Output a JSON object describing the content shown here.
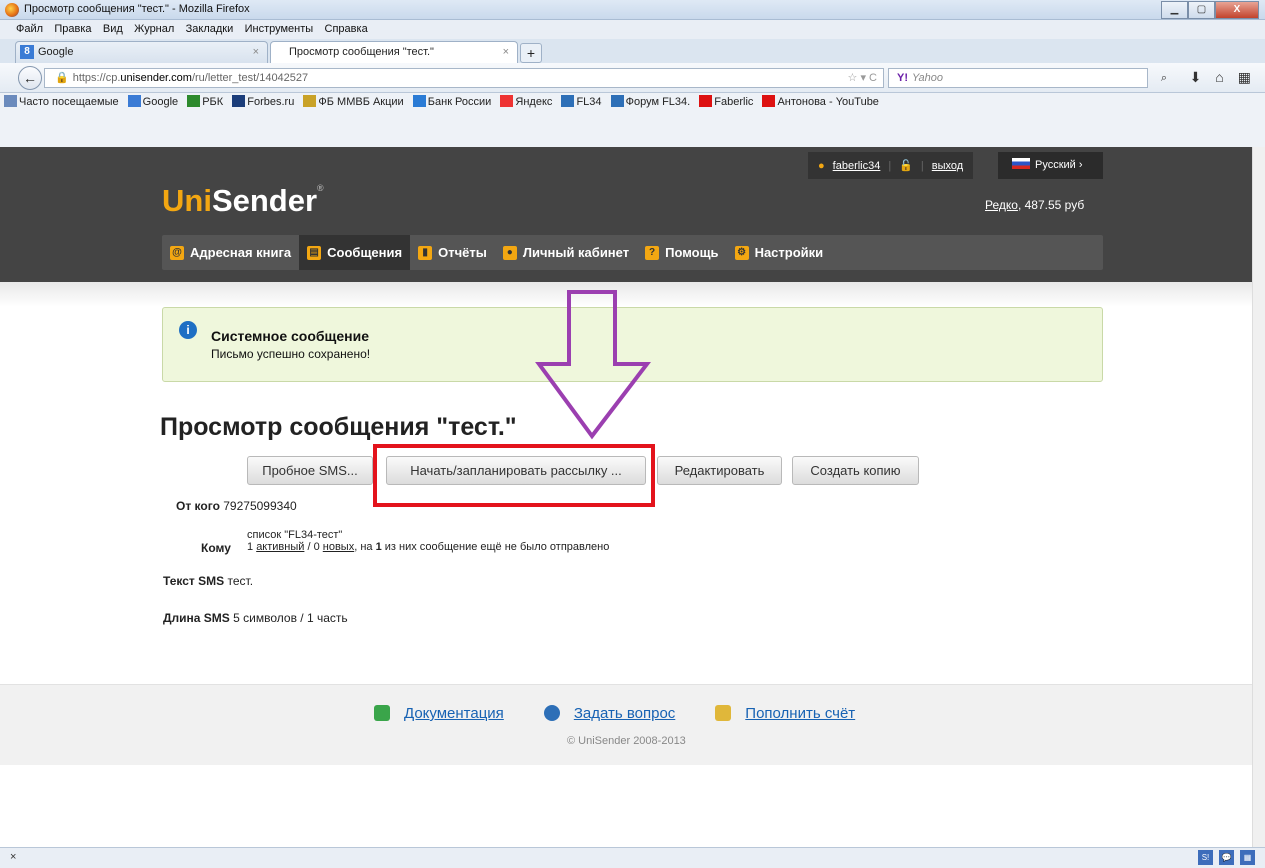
{
  "window": {
    "title": "Просмотр сообщения \"тест.\" - Mozilla Firefox",
    "buttons": {
      "minimize": "▁",
      "maximize": "▢",
      "close": "X"
    }
  },
  "menubar": [
    "Файл",
    "Правка",
    "Вид",
    "Журнал",
    "Закладки",
    "Инструменты",
    "Справка"
  ],
  "tabs": [
    {
      "label": "Google",
      "favicon": "8",
      "active": false
    },
    {
      "label": "Просмотр сообщения \"тест.\"",
      "active": true
    }
  ],
  "newtab_label": "+",
  "url": {
    "prefix": "https://cp.",
    "domain": "unisender.com",
    "path": "/ru/letter_test/14042527"
  },
  "search": {
    "engine": "Y!",
    "placeholder": "Yahoo"
  },
  "bookmarks": [
    "Часто посещаемые",
    "Google",
    "РБК",
    "Forbes.ru",
    "ФБ ММВБ Акции",
    "Банк России",
    "Яндекс",
    "FL34",
    "Форум FL34.",
    "Faberlic",
    "Антонова - YouTube"
  ],
  "header": {
    "logo_part1": "Uni",
    "logo_part2": "Sender",
    "logo_reg": "®",
    "user": "faberlic34",
    "logout": "выход",
    "language": "Русский",
    "balance_link": "Редко",
    "balance_value": ", 487.55 руб"
  },
  "nav": [
    {
      "label": "Адресная книга",
      "icon": "@",
      "active": false
    },
    {
      "label": "Сообщения",
      "icon": "▤",
      "active": true
    },
    {
      "label": "Отчёты",
      "icon": "▮",
      "active": false
    },
    {
      "label": "Личный кабинет",
      "icon": "●",
      "active": false
    },
    {
      "label": "Помощь",
      "icon": "?",
      "active": false
    },
    {
      "label": "Настройки",
      "icon": "⚙",
      "active": false
    }
  ],
  "notice": {
    "title": "Системное сообщение",
    "message": "Письмо успешно сохранено!"
  },
  "page_title": "Просмотр сообщения \"тест.\"",
  "buttons": {
    "trial_sms": "Пробное SMS...",
    "start": "Начать/запланировать рассылку ...",
    "edit": "Редактировать",
    "copy": "Создать копию"
  },
  "details": {
    "from_label": "От кого",
    "from_value": "79275099340",
    "to_label": "Кому",
    "to_list": "список \"FL34-тест\"",
    "to_active_count": "1",
    "to_active": "активный",
    "to_sep": " / ",
    "to_new_count": "0",
    "to_new": "новых",
    "to_rest_1": ", на ",
    "to_rest_bold": "1",
    "to_rest_2": " из них сообщение ещё не было отправлено",
    "text_label": "Текст SMS",
    "text_value": "тест.",
    "length_label": "Длина SMS",
    "length_value": "5 символов / 1 часть"
  },
  "footer": {
    "docs": "Документация",
    "ask": "Задать вопрос",
    "topup": "Пополнить счёт",
    "copyright": "© UniSender 2008-2013"
  },
  "statusbar": {
    "close": "×"
  },
  "colors": {
    "accent": "#f3a712",
    "header": "#444444",
    "highlight": "#e3131c",
    "arrow": "#9b3fb0"
  }
}
